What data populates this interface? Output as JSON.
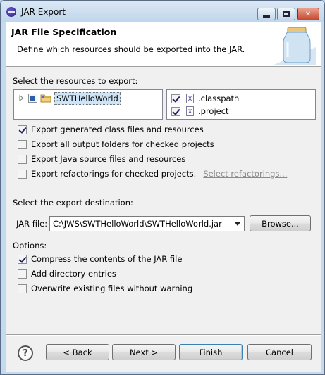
{
  "window": {
    "title": "JAR Export"
  },
  "header": {
    "title": "JAR File Specification",
    "description": "Define which resources should be exported into the JAR."
  },
  "resources": {
    "label": "Select the resources to export:",
    "tree": [
      {
        "label": "SWTHelloWorld",
        "state": "partial"
      }
    ],
    "files": [
      {
        "label": ".classpath",
        "checked": true
      },
      {
        "label": ".project",
        "checked": true
      }
    ]
  },
  "export_options": [
    {
      "label": "Export generated class files and resources",
      "checked": true
    },
    {
      "label": "Export all output folders for checked projects",
      "checked": false
    },
    {
      "label": "Export Java source files and resources",
      "checked": false
    },
    {
      "label": "Export refactorings for checked projects.",
      "checked": false
    }
  ],
  "select_refactorings_link": "Select refactorings...",
  "destination": {
    "label": "Select the export destination:",
    "jar_file_label": "JAR file:",
    "jar_file_value": "C:\\JWS\\SWTHelloWorld\\SWTHelloWorld.jar",
    "browse_label": "Browse..."
  },
  "options": {
    "label": "Options:",
    "items": [
      {
        "label": "Compress the contents of the JAR file",
        "checked": true
      },
      {
        "label": "Add directory entries",
        "checked": false
      },
      {
        "label": "Overwrite existing files without warning",
        "checked": false
      }
    ]
  },
  "buttons": {
    "help": "?",
    "back": "< Back",
    "next": "Next >",
    "finish": "Finish",
    "cancel": "Cancel"
  },
  "colors": {
    "accent_border": "#3c7fb1",
    "title_bar": "#c4daee"
  }
}
